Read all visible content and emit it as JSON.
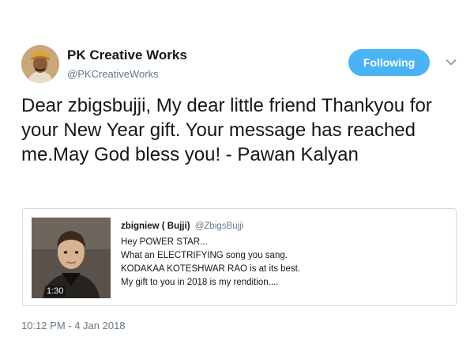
{
  "author": {
    "display_name": "PK Creative Works",
    "handle": "@PKCreativeWorks",
    "avatar_icon": "user-avatar-turban"
  },
  "follow_button": {
    "label": "Following",
    "color": "#4ab3f4"
  },
  "menu": {
    "icon": "chevron-down-icon"
  },
  "tweet": {
    "text": "Dear zbigsbujji, My dear little friend Thankyou for your New Year gift. Your message has reached me.May God bless you! - Pawan Kalyan"
  },
  "quoted_tweet": {
    "display_name": "zbigniew ( Bujji)",
    "handle": "@ZbigsBujji",
    "video_duration": "1:30",
    "lines": [
      "Hey POWER STAR...",
      "What an ELECTRIFYING song you sang.",
      "KODAKAA KOTESHWAR RAO is at its best.",
      "My gift to you in 2018 is my rendition...."
    ]
  },
  "timestamp": "10:12 PM - 4 Jan 2018",
  "colors": {
    "text": "#14171a",
    "secondary": "#657786",
    "border": "#d4dbe1"
  }
}
